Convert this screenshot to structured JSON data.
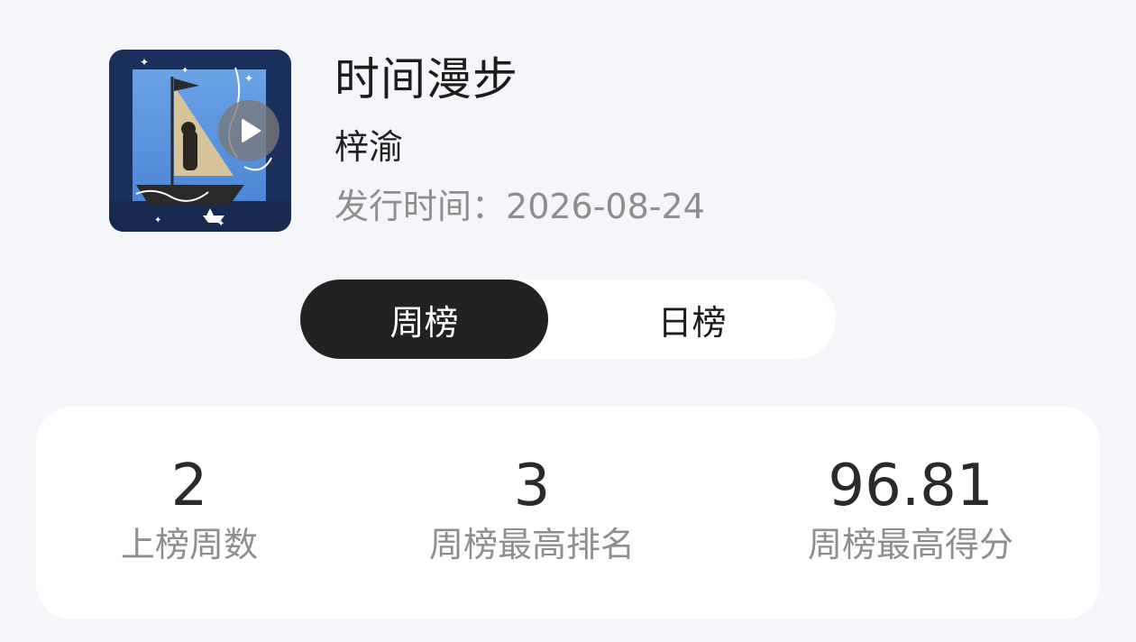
{
  "song": {
    "title": "时间漫步",
    "artist": "梓渝",
    "release_label": "发行时间：",
    "release_date": "2026-08-24"
  },
  "tabs": [
    {
      "label": "周榜",
      "active": true
    },
    {
      "label": "日榜",
      "active": false
    }
  ],
  "stats": [
    {
      "value": "2",
      "label": "上榜周数"
    },
    {
      "value": "3",
      "label": "周榜最高排名"
    },
    {
      "value": "96.81",
      "label": "周榜最高得分"
    }
  ],
  "icons": {
    "play": "play-icon"
  },
  "colors": {
    "background": "#f5f6fa",
    "active_tab": "#222222",
    "muted_text": "#8e8e8e"
  }
}
